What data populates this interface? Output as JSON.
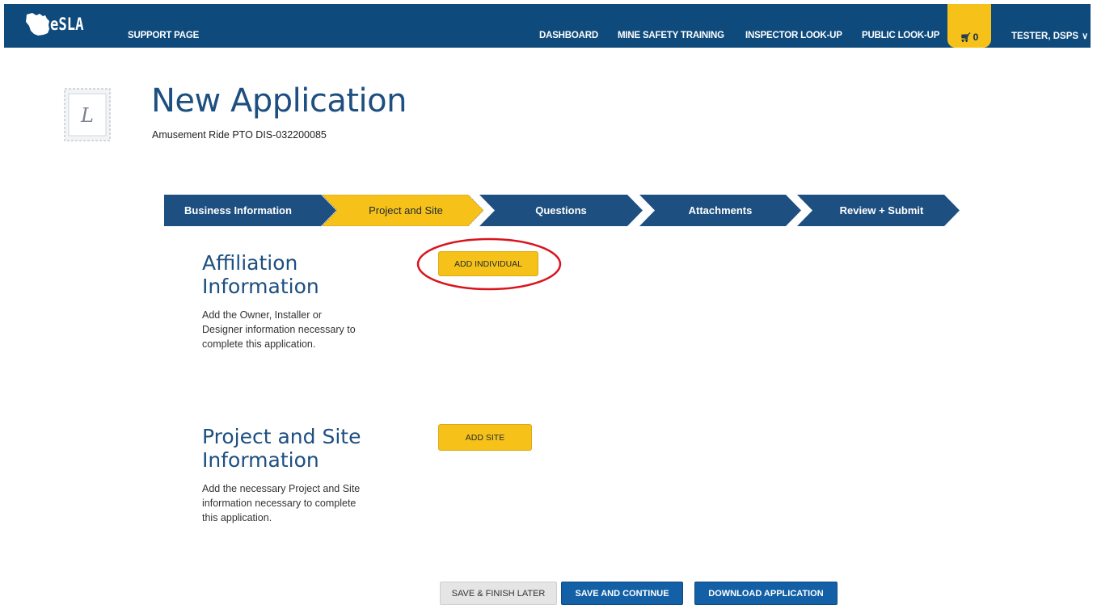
{
  "nav": {
    "logo_text": "eSLA",
    "support": "SUPPORT PAGE",
    "links": [
      "DASHBOARD",
      "MINE SAFETY TRAINING",
      "INSPECTOR LOOK-UP",
      "PUBLIC LOOK-UP"
    ],
    "cart_count": "0",
    "user": "TESTER, DSPS"
  },
  "header": {
    "title": "New Application",
    "subtitle": "Amusement Ride PTO DIS-032200085"
  },
  "steps": [
    {
      "label": "Business Information",
      "state": "done"
    },
    {
      "label": "Project and Site",
      "state": "active"
    },
    {
      "label": "Questions",
      "state": "todo"
    },
    {
      "label": "Attachments",
      "state": "todo"
    },
    {
      "label": "Review + Submit",
      "state": "todo"
    }
  ],
  "affiliation": {
    "title": "Affiliation Information",
    "description": "Add the Owner, Installer or Designer information necessary to complete this application.",
    "button": "ADD INDIVIDUAL"
  },
  "project_site": {
    "title": "Project and Site Information",
    "description": "Add the necessary Project and Site information necessary to complete this application.",
    "button": "ADD SITE"
  },
  "footer": {
    "save_later": "SAVE & FINISH LATER",
    "save_continue": "SAVE AND CONTINUE",
    "download": "DOWNLOAD APPLICATION"
  },
  "icons": [
    "wisconsin-state-icon",
    "cart-icon",
    "chevron-down-icon",
    "seal-icon"
  ],
  "colors": {
    "nav": "#0e4a7c",
    "accent": "#f6c118",
    "primary_text": "#1d4f80",
    "highlight_circle": "#d9141e"
  }
}
